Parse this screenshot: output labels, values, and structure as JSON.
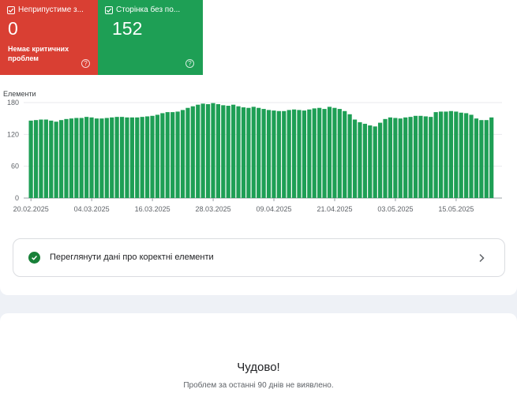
{
  "summary": {
    "error_tile": {
      "label": "Неприпустиме з...",
      "count": "0",
      "description": "Немає критичних проблем",
      "color": "#d93f33"
    },
    "valid_tile": {
      "label": "Сторінка без по...",
      "count": "152",
      "color": "#1e9f55"
    }
  },
  "chart_data": {
    "type": "bar",
    "ylabel": "Елементи",
    "ylim": [
      0,
      180
    ],
    "yticks": [
      0,
      60,
      120,
      180
    ],
    "x_ticks": [
      "20.02.2025",
      "04.03.2025",
      "16.03.2025",
      "28.03.2025",
      "09.04.2025",
      "21.04.2025",
      "03.05.2025",
      "15.05.2025"
    ],
    "start_date": "20.02.2025",
    "bar_color": "#1e9f55",
    "grid": true,
    "values": [
      146,
      147,
      148,
      148,
      146,
      144,
      147,
      149,
      150,
      151,
      151,
      153,
      152,
      150,
      150,
      151,
      152,
      153,
      153,
      152,
      152,
      152,
      153,
      154,
      155,
      157,
      160,
      162,
      162,
      163,
      166,
      170,
      173,
      176,
      178,
      177,
      179,
      177,
      175,
      174,
      176,
      173,
      171,
      170,
      172,
      170,
      168,
      166,
      165,
      164,
      164,
      166,
      167,
      166,
      165,
      167,
      169,
      170,
      168,
      172,
      170,
      168,
      164,
      158,
      148,
      143,
      140,
      137,
      135,
      142,
      149,
      152,
      151,
      150,
      152,
      153,
      155,
      155,
      154,
      153,
      162,
      163,
      163,
      164,
      163,
      161,
      160,
      157,
      150,
      147,
      147,
      152
    ]
  },
  "link_card": {
    "label": "Переглянути дані про коректні елементи"
  },
  "empty_state": {
    "title": "Чудово!",
    "subtitle": "Проблем за останні 90 днів не виявлено."
  }
}
